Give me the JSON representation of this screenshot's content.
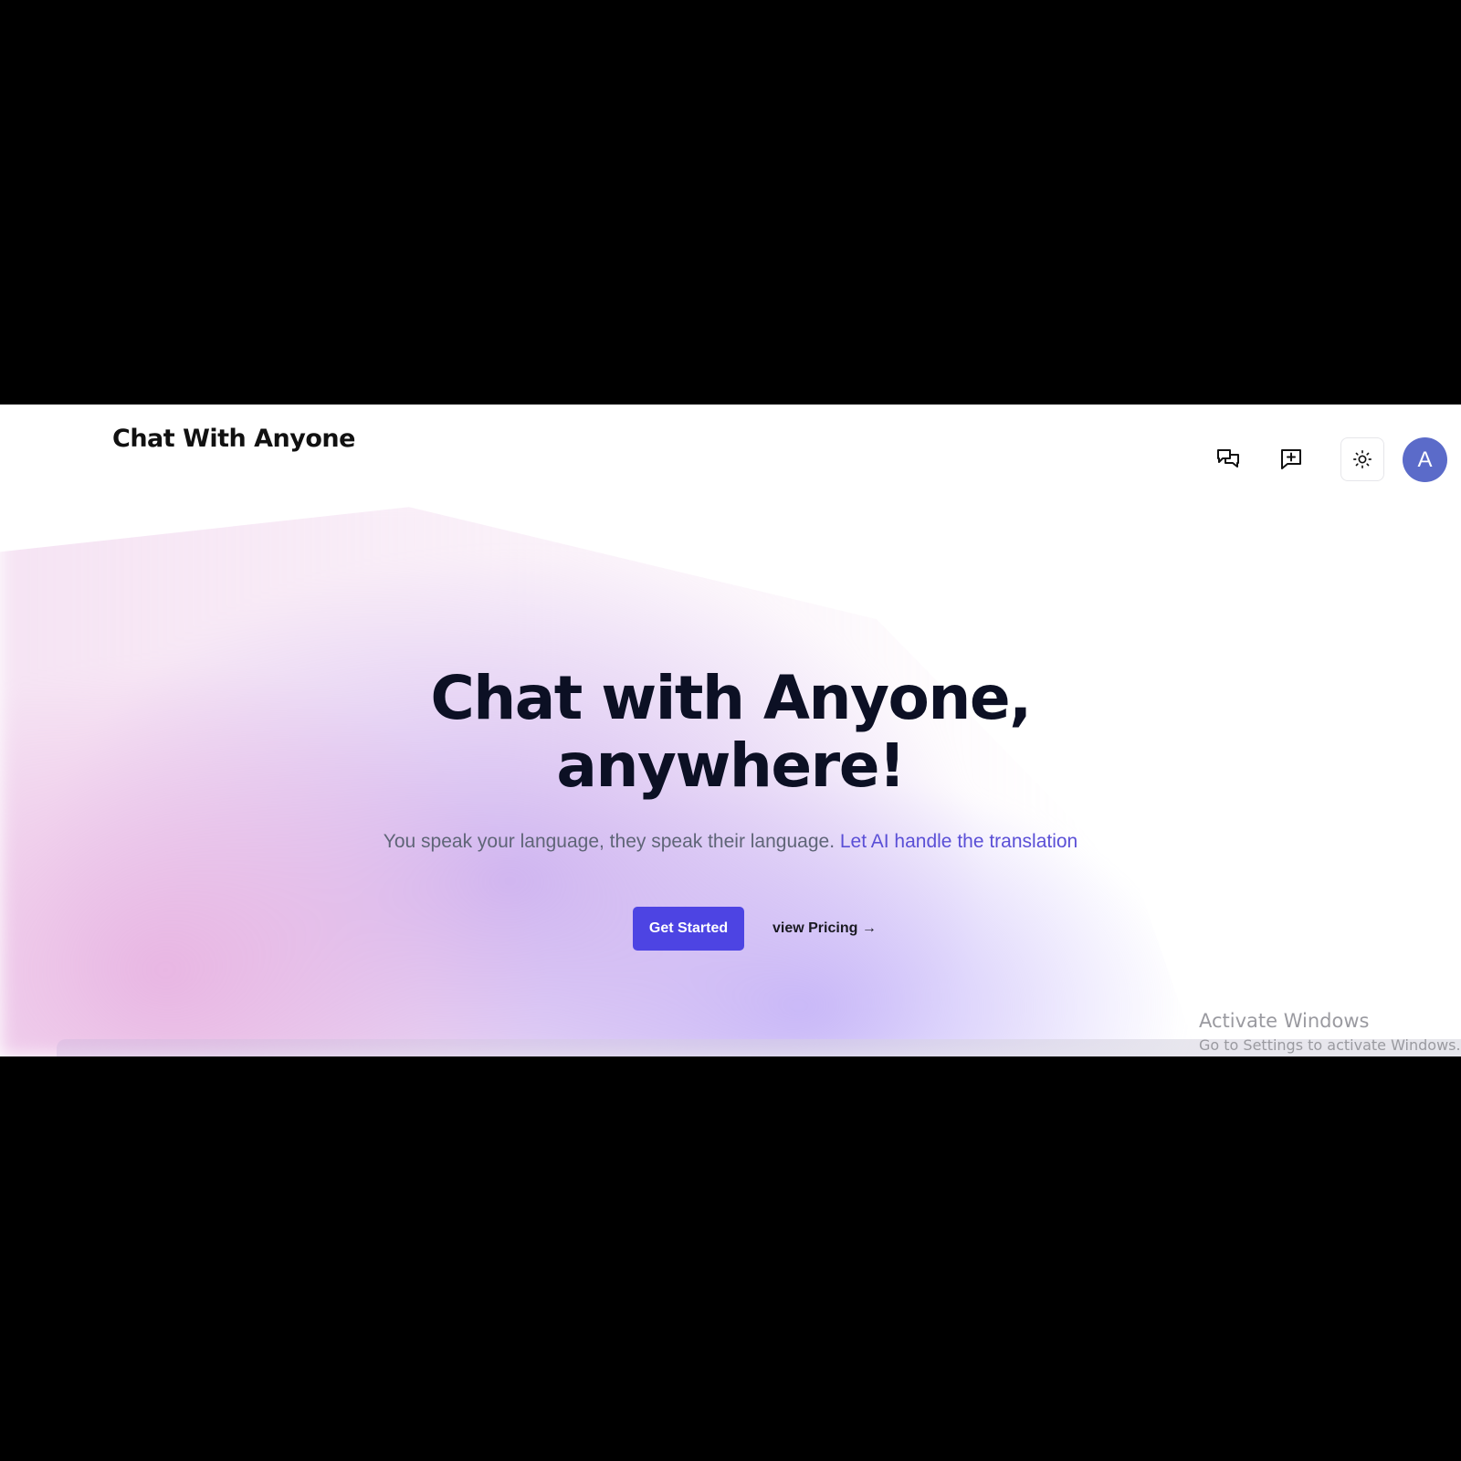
{
  "app": {
    "logo": "Chat With Anyone"
  },
  "nav": {
    "icons": [
      "chats-icon",
      "new-chat-icon",
      "sun-icon"
    ],
    "avatar_initial": "A",
    "avatar_color": "#5b6bc9"
  },
  "hero": {
    "title_line1": "Chat with Anyone,",
    "title_line2": "anywhere!",
    "subtitle": "You speak your language, they speak their language.",
    "subtitle_accent": "Let AI handle the translation",
    "cta_primary": "Get Started",
    "cta_secondary": "view Pricing →"
  },
  "watermark": {
    "title": "Activate Windows",
    "subtitle": "Go to Settings to activate Windows."
  },
  "colors": {
    "primary": "#4d44e3",
    "accent_text": "#5a4fd6",
    "title_text": "#0c1024"
  }
}
